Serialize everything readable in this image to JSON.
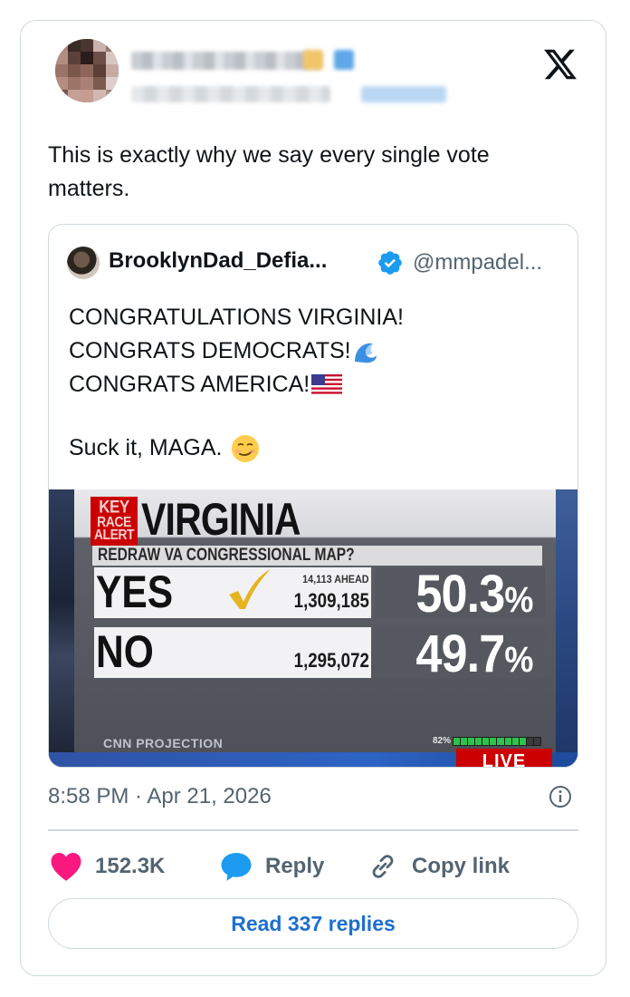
{
  "author": {
    "name": "",
    "handle": ""
  },
  "tweet": {
    "text": "This is exactly why we say every single vote matters.",
    "timestamp": "8:58 PM · Apr 21, 2026"
  },
  "quoted": {
    "name": "BrooklynDad_Defia...",
    "handle": "@mmpadel...",
    "lines": [
      "CONGRATULATIONS VIRGINIA!",
      "CONGRATS DEMOCRATS!",
      "CONGRATS AMERICA!",
      "Suck it, MAGA."
    ],
    "image": {
      "key_race_alert": [
        "KEY",
        "RACE",
        "ALERT"
      ],
      "title": "VIRGINIA",
      "subtitle": "REDRAW VA CONGRESSIONAL MAP?",
      "rows": [
        {
          "label": "YES",
          "ahead": "14,113 AHEAD",
          "votes": "1,309,185",
          "pct": "50.3",
          "pct_sign": "%"
        },
        {
          "label": "NO",
          "ahead": "",
          "votes": "1,295,072",
          "pct": "49.7",
          "pct_sign": "%"
        }
      ],
      "projection": "CNN PROJECTION",
      "estimated": "82%",
      "estimated_fraction": 0.82,
      "live": "LIVE"
    }
  },
  "actions": {
    "likes": "152.3K",
    "reply": "Reply",
    "copy_link": "Copy link",
    "read_replies": "Read 337 replies"
  },
  "colors": {
    "like": "#f91880",
    "reply": "#1d9bf0",
    "link": "#1d6fd0",
    "verified": "#1d9bf0",
    "cnn_red": "#cc0000"
  },
  "icons": [
    "x-logo-icon",
    "verified-icon",
    "wave-emoji",
    "us-flag-emoji",
    "smirk-emoji",
    "info-icon",
    "heart-icon",
    "reply-bubble-icon",
    "link-icon"
  ]
}
